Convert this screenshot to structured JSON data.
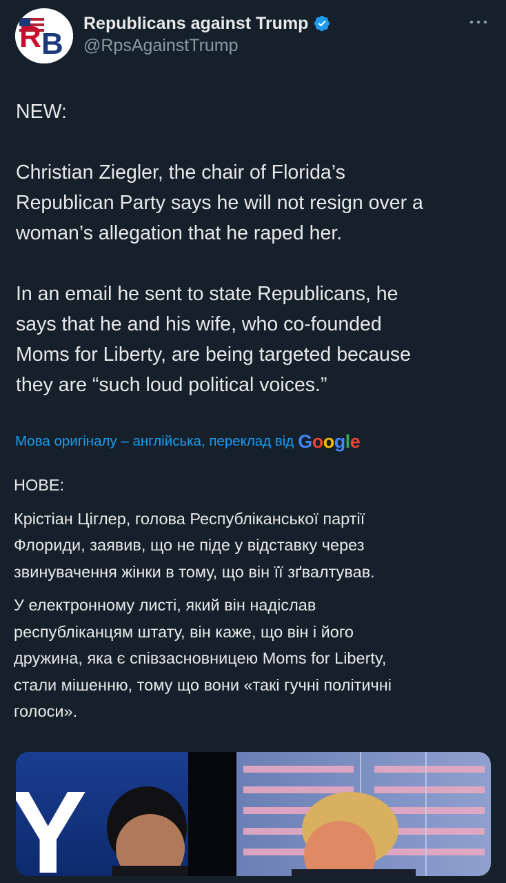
{
  "author": {
    "display_name": "Republicans against Trump",
    "handle": "@RpsAgainstTrump",
    "avatar_icon": "rb-logo-avatar",
    "avatar_text": "RB",
    "verified_icon": "verified-badge-icon",
    "verified_color": "#1d9bf0"
  },
  "menu": {
    "icon": "more-options-icon"
  },
  "tweet": {
    "paragraphs": [
      [
        "NEW:"
      ],
      [
        "Christian Ziegler, the chair of Florida’s",
        "Republican Party says he will not resign over a",
        "woman’s allegation that he raped her."
      ],
      [
        "In an email he sent to state Republicans, he",
        "says that he and his wife, who co-founded",
        "Moms for Liberty, are being targeted because",
        "they are “such loud political voices.”"
      ]
    ]
  },
  "translation": {
    "note": "Мова оригіналу – англійська, переклад від",
    "provider": "Google",
    "paragraphs": [
      [
        "НОВЕ:"
      ],
      [
        "Крістіан Ціглер, голова Республіканської партії",
        "Флориди, заявив, що не піде у відставку через",
        "звинувачення жінки в тому, що він її зґвалтував."
      ],
      [
        "У електронному листі, який він надіслав",
        "республіканцям штату, він каже, що він і його",
        "дружина, яка є співзасновницею Moms for Liberty,",
        "стали мішенню, тому що вони «такі гучні політичні",
        "голоси»."
      ]
    ]
  },
  "media": {
    "type": "photo",
    "backdrop_text": "Y"
  },
  "colors": {
    "background": "#15202b",
    "text": "#e7e9ea",
    "secondary": "#8b98a5",
    "link": "#1d9bf0"
  }
}
